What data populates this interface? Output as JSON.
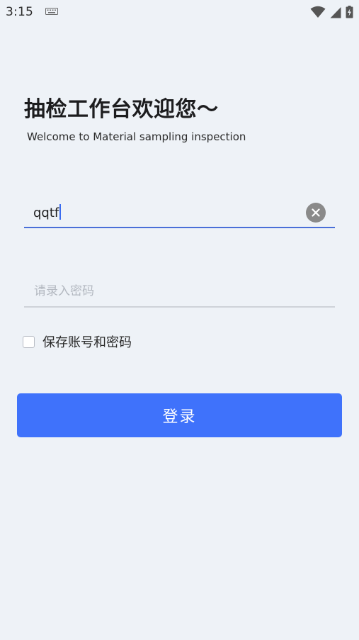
{
  "status_bar": {
    "time": "3:15",
    "icons": [
      "keyboard-icon",
      "wifi-icon",
      "signal-icon",
      "battery-charging-icon"
    ]
  },
  "header": {
    "title": "抽检工作台欢迎您～",
    "subtitle": "Welcome to Material sampling inspection"
  },
  "form": {
    "username_value": "qqtf",
    "password_placeholder": "请录入密码",
    "password_value": "",
    "remember_label": "保存账号和密码",
    "remember_checked": false,
    "login_label": "登录"
  },
  "colors": {
    "background": "#eef2f7",
    "accent": "#3f72fb",
    "active_underline": "#4a6fd8",
    "inactive_underline": "#cfd3d9",
    "clear_button": "#8a8a8a"
  }
}
